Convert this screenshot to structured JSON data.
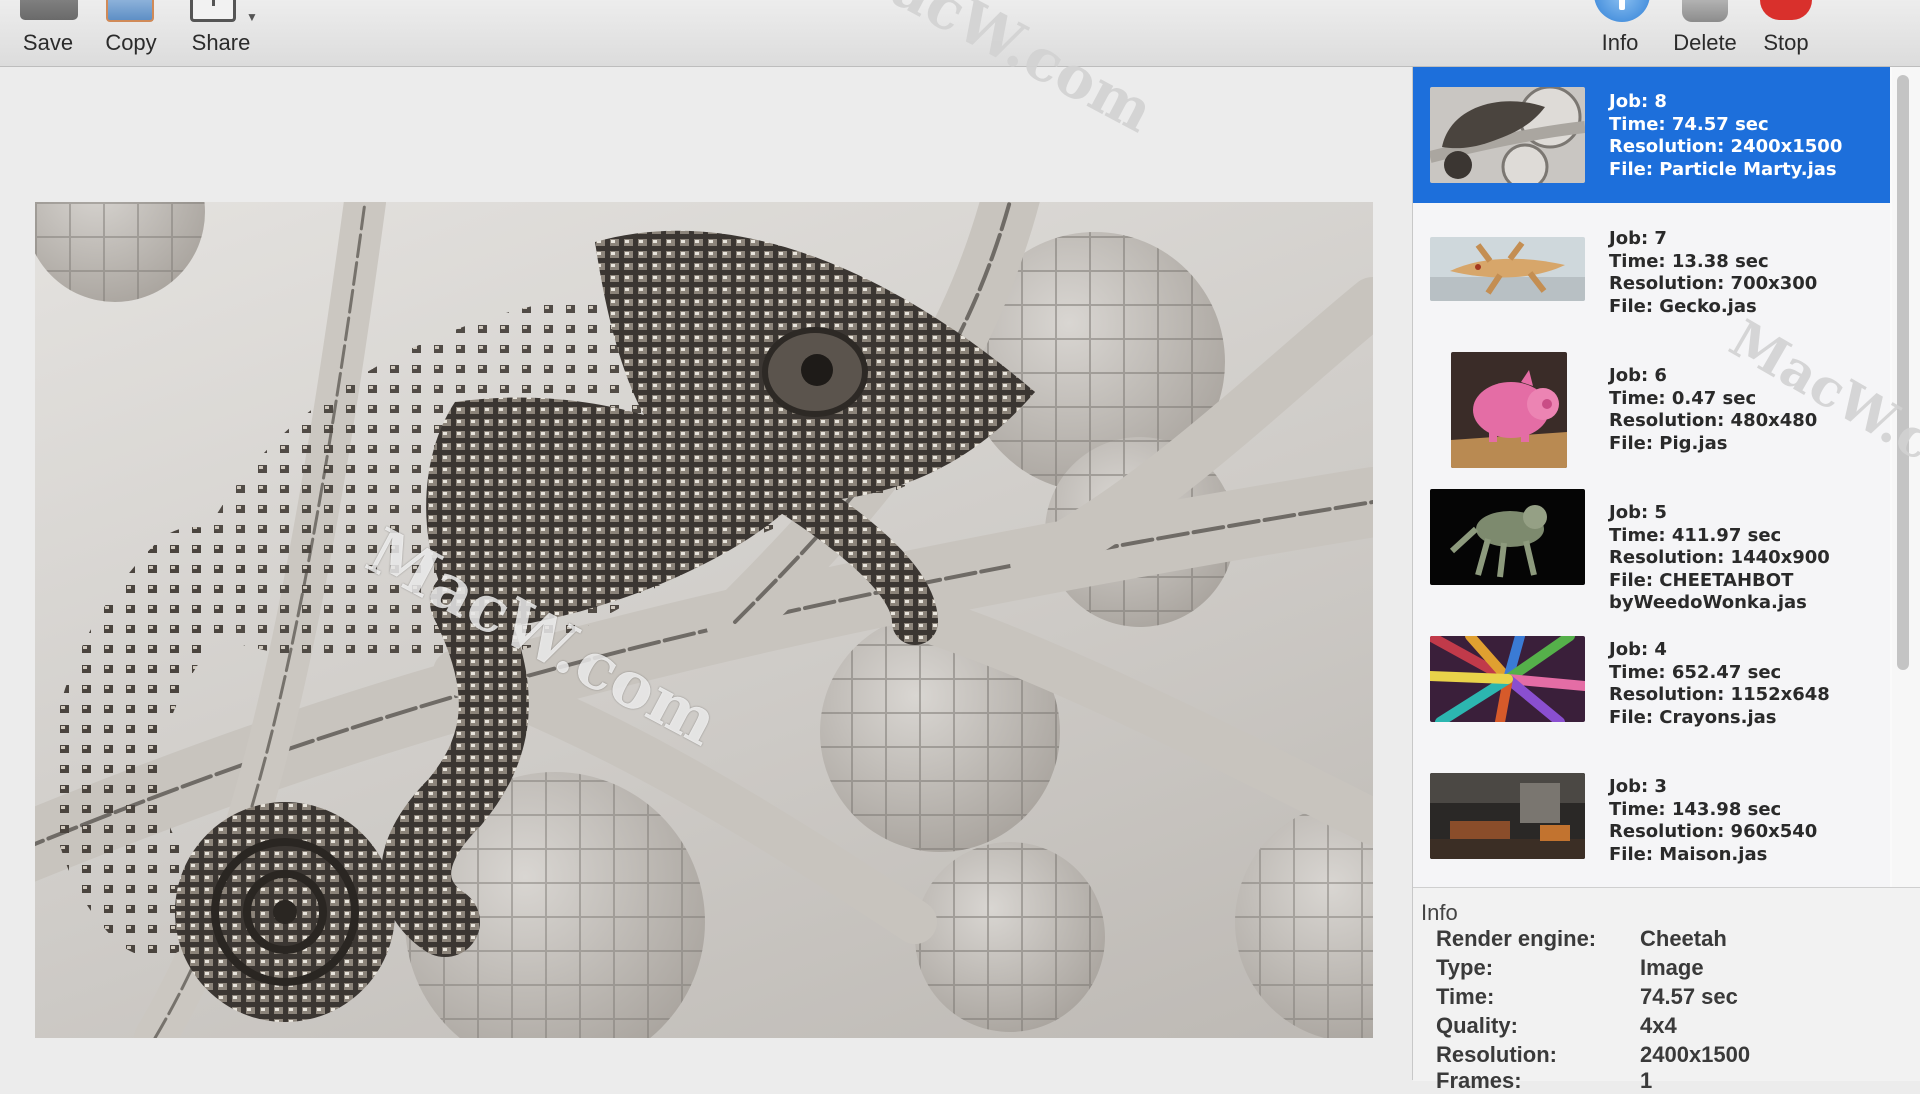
{
  "toolbar": {
    "save": "Save",
    "copy": "Copy",
    "share": "Share",
    "info": "Info",
    "delete": "Delete",
    "stop": "Stop"
  },
  "watermark": {
    "w1": "MacW.com",
    "w2": "MacW.com",
    "w3": "MacW.c"
  },
  "jobs": [
    {
      "job": "Job: 8",
      "time": "Time: 74.57 sec",
      "resolution": "Resolution: 2400x1500",
      "file": "File: Particle Marty.jas",
      "file2": ""
    },
    {
      "job": "Job: 7",
      "time": "Time: 13.38 sec",
      "resolution": "Resolution: 700x300",
      "file": "File: Gecko.jas",
      "file2": ""
    },
    {
      "job": "Job: 6",
      "time": "Time: 0.47 sec",
      "resolution": "Resolution: 480x480",
      "file": "File: Pig.jas",
      "file2": ""
    },
    {
      "job": "Job: 5",
      "time": "Time: 411.97 sec",
      "resolution": "Resolution: 1440x900",
      "file": "File: CHEETAHBOT",
      "file2": "byWeedoWonka.jas"
    },
    {
      "job": "Job: 4",
      "time": "Time: 652.47 sec",
      "resolution": "Resolution: 1152x648",
      "file": "File: Crayons.jas",
      "file2": ""
    },
    {
      "job": "Job: 3",
      "time": "Time: 143.98 sec",
      "resolution": "Resolution: 960x540",
      "file": "File: Maison.jas",
      "file2": ""
    }
  ],
  "info": {
    "title": "Info",
    "rows": [
      {
        "key": "Render engine:",
        "value": "Cheetah"
      },
      {
        "key": "Type:",
        "value": "Image"
      },
      {
        "key": "Time:",
        "value": "74.57 sec"
      },
      {
        "key": "Quality:",
        "value": "4x4"
      },
      {
        "key": "Resolution:",
        "value": "2400x1500"
      },
      {
        "key": "Frames:",
        "value": "1"
      }
    ]
  },
  "colors": {
    "selection": "#1d6fdb",
    "stop": "#d9302c",
    "info_icon": "#2f7fd6"
  }
}
